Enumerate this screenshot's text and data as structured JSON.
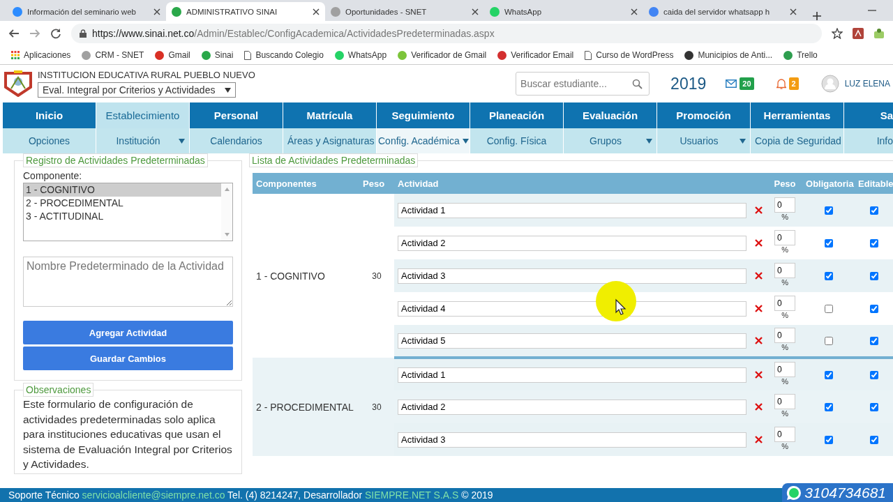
{
  "browser": {
    "tabs": [
      {
        "title": "Información del seminario web",
        "selected": false,
        "color": "#2d8cff"
      },
      {
        "title": "ADMINISTRATIVO SINAI",
        "selected": true,
        "color": "#2aa84a"
      },
      {
        "title": "Oportunidades - SNET",
        "selected": false,
        "color": "#a0a0a0"
      },
      {
        "title": "WhatsApp",
        "selected": false,
        "color": "#25d366"
      },
      {
        "title": "caida del servidor whatsapp h",
        "selected": false,
        "color": "#4285f4"
      }
    ],
    "url_host": "https://www.sinai.net.co",
    "url_path": "/Admin/Establec/ConfigAcademica/ActividadesPredeterminadas.aspx",
    "bookmarks": [
      {
        "label": "Aplicaciones",
        "kind": "apps"
      },
      {
        "label": "CRM - SNET",
        "kind": "logo",
        "color": "#a0a0a0"
      },
      {
        "label": "Gmail",
        "kind": "logo",
        "color": "#d93025"
      },
      {
        "label": "Sinai",
        "kind": "logo",
        "color": "#2aa84a"
      },
      {
        "label": "Buscando Colegio",
        "kind": "page"
      },
      {
        "label": "WhatsApp",
        "kind": "logo",
        "color": "#25d366"
      },
      {
        "label": "Verificador de Gmail",
        "kind": "logo",
        "color": "#7cc43a"
      },
      {
        "label": "Verificador Email",
        "kind": "logo",
        "color": "#d32f2f"
      },
      {
        "label": "Curso de WordPress",
        "kind": "page"
      },
      {
        "label": "Municipios de Anti...",
        "kind": "logo",
        "color": "#333333"
      },
      {
        "label": "Trello",
        "kind": "logo",
        "color": "#2e9e4f"
      }
    ]
  },
  "header": {
    "institution": "INSTITUCION EDUCATIVA RURAL PUEBLO NUEVO",
    "mode": "Eval. Integral por Criterios y Actividades",
    "search_placeholder": "Buscar estudiante...",
    "year": "2019",
    "messages": "20",
    "alerts": "2",
    "user": "LUZ ELENA"
  },
  "nav": [
    {
      "label": "Inicio",
      "selected": false
    },
    {
      "label": "Establecimiento",
      "selected": true
    },
    {
      "label": "Personal",
      "selected": false
    },
    {
      "label": "Matrícula",
      "selected": false
    },
    {
      "label": "Seguimiento",
      "selected": false
    },
    {
      "label": "Planeación",
      "selected": false
    },
    {
      "label": "Evaluación",
      "selected": false
    },
    {
      "label": "Promoción",
      "selected": false
    },
    {
      "label": "Herramientas",
      "selected": false
    },
    {
      "label": "Sa",
      "selected": false
    }
  ],
  "subnav": [
    {
      "label": "Opciones",
      "dropdown": false,
      "selected": false
    },
    {
      "label": "Institución",
      "dropdown": true,
      "selected": false
    },
    {
      "label": "Calendarios",
      "dropdown": false,
      "selected": false
    },
    {
      "label": "Áreas y Asignaturas",
      "dropdown": false,
      "selected": false
    },
    {
      "label": "Config. Académica",
      "dropdown": true,
      "selected": true
    },
    {
      "label": "Config. Física",
      "dropdown": false,
      "selected": false
    },
    {
      "label": "Grupos",
      "dropdown": true,
      "selected": false
    },
    {
      "label": "Usuarios",
      "dropdown": true,
      "selected": false
    },
    {
      "label": "Copia de Seguridad",
      "dropdown": false,
      "selected": false
    },
    {
      "label": "Info",
      "dropdown": false,
      "selected": false
    }
  ],
  "registro": {
    "title": "Registro de Actividades Predeterminadas",
    "component_label": "Componente:",
    "components": [
      {
        "label": "1 - COGNITIVO",
        "selected": true
      },
      {
        "label": "2 - PROCEDIMENTAL",
        "selected": false
      },
      {
        "label": "3 - ACTITUDINAL",
        "selected": false
      }
    ],
    "name_placeholder": "Nombre Predeterminado de la Actividad",
    "buttons": [
      "Agregar Actividad",
      "Guardar Cambios"
    ]
  },
  "observaciones": {
    "title": "Observaciones",
    "text": "Este formulario de configuración de actividades predeterminadas solo aplica para instituciones educativas que usan el sistema de Evaluación Integral por Criterios y Actividades."
  },
  "lista": {
    "title": "Lista de Actividades Predeterminadas",
    "columns": [
      "Componentes",
      "Peso",
      "Actividad",
      "Peso",
      "Obligatoria",
      "Editable"
    ],
    "groups": [
      {
        "component": "1 - COGNITIVO",
        "peso": "30",
        "activities": [
          {
            "name": "Actividad 1",
            "peso": "0",
            "unit": "%",
            "obligatoria": true,
            "editable": true
          },
          {
            "name": "Actividad 2",
            "peso": "0",
            "unit": "%",
            "obligatoria": true,
            "editable": true
          },
          {
            "name": "Actividad 3",
            "peso": "0",
            "unit": "%",
            "obligatoria": true,
            "editable": true
          },
          {
            "name": "Actividad 4",
            "peso": "0",
            "unit": "%",
            "obligatoria": false,
            "editable": true
          },
          {
            "name": "Actividad 5",
            "peso": "0",
            "unit": "%",
            "obligatoria": false,
            "editable": true
          }
        ]
      },
      {
        "component": "2 - PROCEDIMENTAL",
        "peso": "30",
        "activities": [
          {
            "name": "Actividad 1",
            "peso": "0",
            "unit": "%",
            "obligatoria": true,
            "editable": true
          },
          {
            "name": "Actividad 2",
            "peso": "0",
            "unit": "%",
            "obligatoria": true,
            "editable": true
          },
          {
            "name": "Actividad 3",
            "peso": "0",
            "unit": "%",
            "obligatoria": true,
            "editable": true
          }
        ]
      }
    ]
  },
  "footer": {
    "label": "Soporte Técnico",
    "email": "servicioalcliente@siempre.net.co",
    "tel": "Tel. (4) 8214247, Desarrollador",
    "company": "SIEMPRE.NET S.A.S",
    "copyright": "© 2019",
    "whatsapp": "3104734681"
  }
}
